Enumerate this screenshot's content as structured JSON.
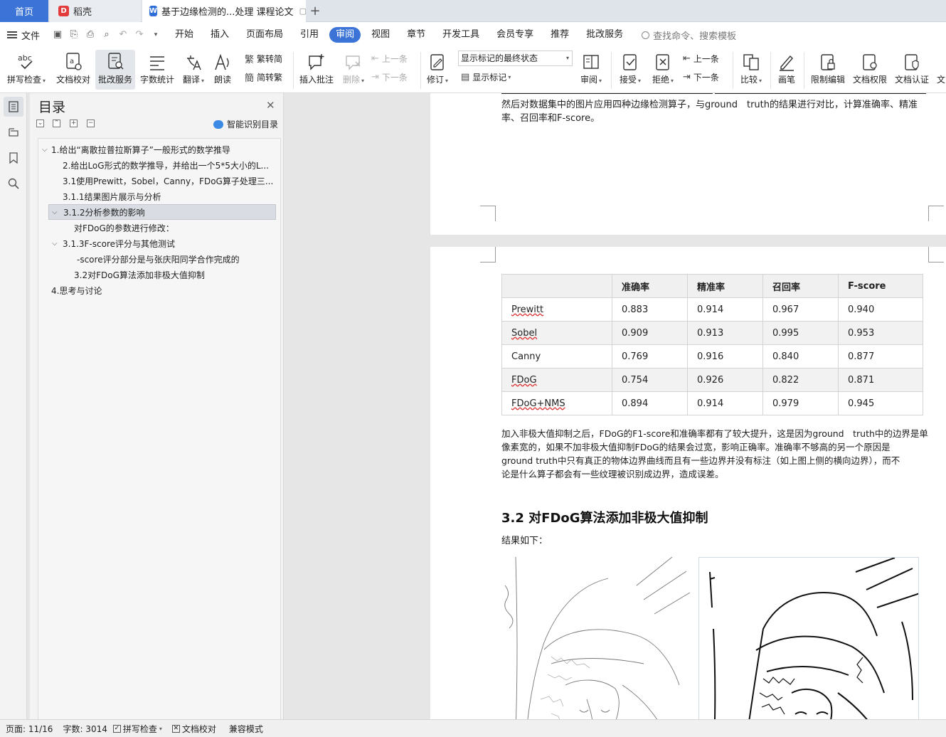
{
  "tabs": {
    "home": "首页",
    "daoke": "稻壳",
    "doc": "基于边缘检测的...处理 课程论文"
  },
  "menu": {
    "file": "文件",
    "items": [
      "开始",
      "插入",
      "页面布局",
      "引用",
      "审阅",
      "视图",
      "章节",
      "开发工具",
      "会员专享",
      "推荐",
      "批改服务"
    ],
    "active": "审阅",
    "search": "查找命令、搜索模板"
  },
  "ribbon": {
    "spell": "拼写检查",
    "proof": "文档校对",
    "review_service": "批改服务",
    "word_count": "字数统计",
    "translate": "翻译",
    "read": "朗读",
    "trad_to_simp": "繁转简",
    "simp_to_trad": "简转繁",
    "insert_comment": "插入批注",
    "delete": "删除",
    "prev": "上一条",
    "next": "下一条",
    "revise": "修订",
    "markup_state": "显示标记的最终状态",
    "show_markup": "显示标记",
    "review": "审阅",
    "accept": "接受",
    "reject": "拒绝",
    "prev2": "上一条",
    "next2": "下一条",
    "compare": "比较",
    "pen": "画笔",
    "restrict": "限制编辑",
    "doc_rights": "文档权限",
    "doc_cert": "文档认证",
    "more": "文"
  },
  "toc": {
    "title": "目录",
    "smart": "智能识别目录",
    "items": [
      "1.给出“离散拉普拉斯算子”一般形式的数学推导",
      "2.给出LoG形式的数学推导，并给出一个5*5大小的L...",
      "3.1使用Prewitt，Sobel，Canny，FDoG算子处理三...",
      "3.1.1结果图片展示与分析",
      "3.1.2分析参数的影响",
      "对FDoG的参数进行修改：",
      "3.1.3F-score评分与其他测试",
      "-score评分部分是与张庆阳同学合作完成的",
      "3.2对FDoG算法添加非极大值抑制",
      "4.思考与讨论"
    ]
  },
  "doc": {
    "p1_line1": "然后对数据集中的图片应用四种边缘检测算子，与ground　truth的结果进行对比，计算准确率、精准",
    "p1_line2": "率、召回率和F-score。",
    "table": {
      "headers": [
        "",
        "准确率",
        "精准率",
        "召回率",
        "F-score"
      ],
      "rows": [
        [
          "Prewitt",
          "0.883",
          "0.914",
          "0.967",
          "0.940"
        ],
        [
          "Sobel",
          "0.909",
          "0.913",
          "0.995",
          "0.953"
        ],
        [
          "Canny",
          "0.769",
          "0.916",
          "0.840",
          "0.877"
        ],
        [
          "FDoG",
          "0.754",
          "0.926",
          "0.822",
          "0.871"
        ],
        [
          "FDoG+NMS",
          "0.894",
          "0.914",
          "0.979",
          "0.945"
        ]
      ]
    },
    "p2_line1": "加入非极大值抑制之后，FDoG的F1-score和准确率都有了较大提升，这是因为ground　truth中的边界是单",
    "p2_line2": "像素宽的，如果不加非极大值抑制FDoG的结果会过宽，影响正确率。准确率不够高的另一个原因是",
    "p2_line3": "ground truth中只有真正的物体边界曲线而且有一些边界并没有标注（如上图上侧的横向边界），而不",
    "p2_line4": "论是什么算子都会有一些纹理被识别成边界，造成误差。",
    "heading": "3.2 对FDoG算法添加非极大值抑制",
    "result_label": "结果如下："
  },
  "status": {
    "page": "页面: 11/16",
    "words": "字数: 3014",
    "spell": "拼写检查",
    "proof": "文档校对",
    "compat": "兼容模式"
  },
  "colors": {
    "accent": "#3b74d6",
    "page": "#ffffff",
    "canvas": "#e6e6e6"
  }
}
